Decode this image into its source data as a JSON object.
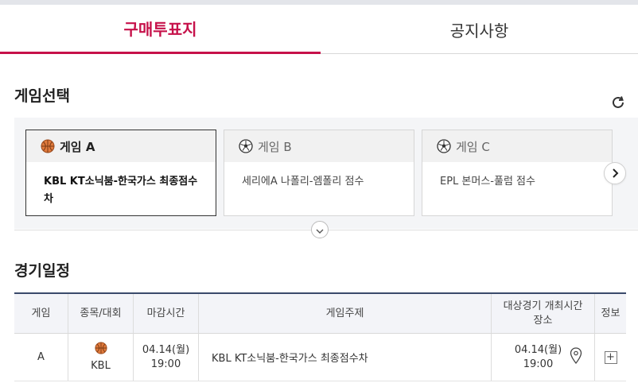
{
  "tabs": [
    {
      "label": "구매투표지",
      "active": true
    },
    {
      "label": "공지사항",
      "active": false
    }
  ],
  "game_select": {
    "title": "게임선택",
    "cards": [
      {
        "name": "게임 A",
        "icon": "basketball-icon",
        "desc": "KBL KT소닉붐-한국가스 최종점수차",
        "selected": true
      },
      {
        "name": "게임 B",
        "icon": "soccer-ball-icon",
        "desc": "세리에A 나폴리-엠폴리 점수",
        "selected": false
      },
      {
        "name": "게임 C",
        "icon": "soccer-ball-icon",
        "desc": "EPL 본머스-풀럼 점수",
        "selected": false
      }
    ]
  },
  "schedule": {
    "title": "경기일정",
    "headers": {
      "game": "게임",
      "sport": "종목/대회",
      "deadline": "마감시간",
      "subject": "게임주제",
      "match_time": "대상경기 개최시간",
      "venue": "장소",
      "info": "정보"
    },
    "rows": [
      {
        "game": "A",
        "sport_icon": "basketball-icon",
        "league": "KBL",
        "deadline_date": "04.14(월)",
        "deadline_time": "19:00",
        "subject": "KBL KT소닉붐-한국가스 최종점수차",
        "match_date": "04.14(월)",
        "match_time": "19:00",
        "info_label": "+"
      }
    ]
  },
  "colors": {
    "accent": "#c6114a",
    "table_border": "#3a4a6b"
  }
}
